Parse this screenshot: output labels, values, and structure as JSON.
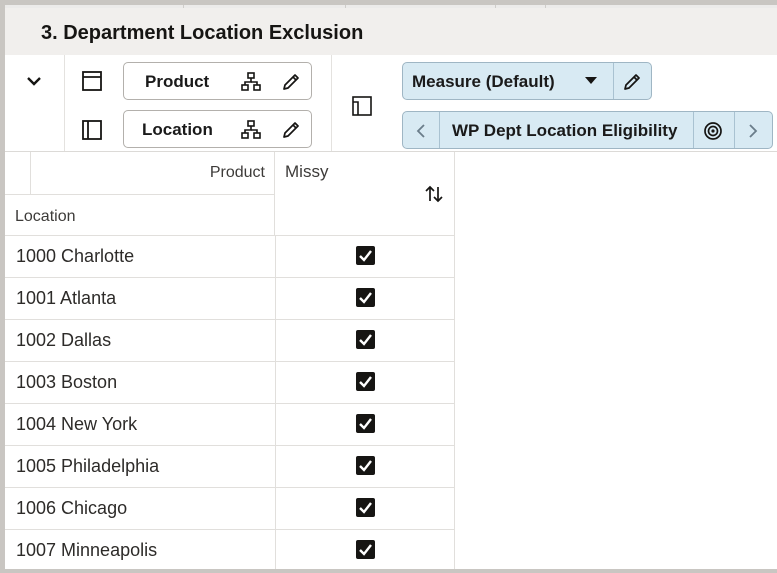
{
  "page": {
    "title": "3. Department Location Exclusion"
  },
  "toolbar": {
    "product_label": "Product",
    "location_label": "Location",
    "measure_label": "Measure (Default)",
    "view_label": "WP Dept Location Eligibility"
  },
  "grid": {
    "row_header_product": "Product",
    "row_header_location": "Location",
    "column_header": "Missy",
    "rows": [
      {
        "name": "1000 Charlotte",
        "checked": true
      },
      {
        "name": "1001 Atlanta",
        "checked": true
      },
      {
        "name": "1002 Dallas",
        "checked": true
      },
      {
        "name": "1003 Boston",
        "checked": true
      },
      {
        "name": "1004 New York",
        "checked": true
      },
      {
        "name": "1005 Philadelphia",
        "checked": true
      },
      {
        "name": "1006 Chicago",
        "checked": true
      },
      {
        "name": "1007 Minneapolis",
        "checked": true
      }
    ]
  },
  "icons": {
    "collapse": "chevron-down-icon",
    "layout_rows": "layout-rows-icon",
    "layout_columns": "layout-columns-icon",
    "hierarchy": "hierarchy-icon",
    "edit": "pencil-icon",
    "pivot": "pivot-icon",
    "dropdown": "caret-down-icon",
    "prev": "chevron-left-icon",
    "next": "chevron-right-icon",
    "target": "target-icon",
    "sort": "sort-icon",
    "checkbox": "checkbox-checked-icon"
  },
  "colors": {
    "title_bar": "#f1efed",
    "measure_pill": "#d8eaf3",
    "checkbox": "#161513"
  }
}
